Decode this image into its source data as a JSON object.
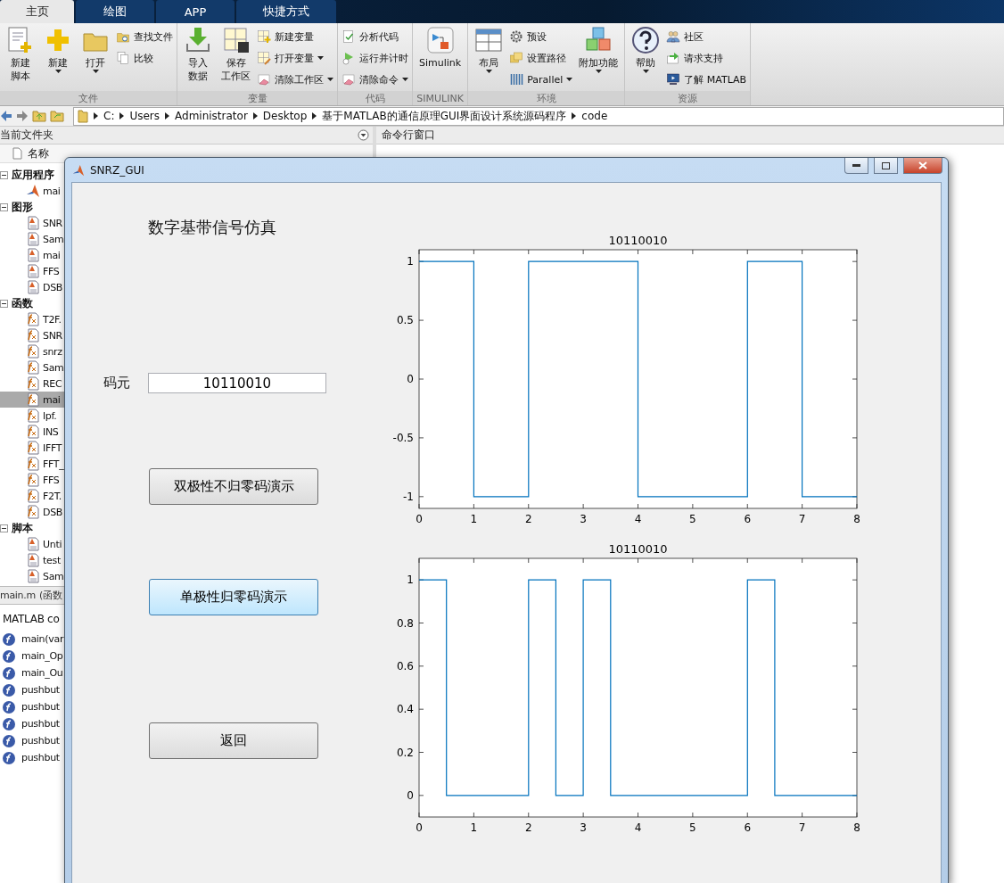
{
  "ribbon_tabs": [
    {
      "label": "主页",
      "selected": true
    },
    {
      "label": "绘图",
      "selected": false
    },
    {
      "label": "APP",
      "selected": false
    },
    {
      "label": "快捷方式",
      "selected": false
    }
  ],
  "ribbon_groups": [
    {
      "label": "文件",
      "items": [
        {
          "kind": "large",
          "lines": [
            "新建",
            "脚本"
          ],
          "dropdown": false
        },
        {
          "kind": "large",
          "lines": [
            "新建"
          ],
          "dropdown": true
        },
        {
          "kind": "large",
          "lines": [
            "打开"
          ],
          "dropdown": true
        },
        {
          "kind": "stack",
          "buttons": [
            {
              "label": "查找文件",
              "dropdown": false
            },
            {
              "label": "比较",
              "dropdown": false
            }
          ]
        }
      ]
    },
    {
      "label": "变量",
      "items": [
        {
          "kind": "large",
          "lines": [
            "导入",
            "数据"
          ],
          "dropdown": false
        },
        {
          "kind": "large",
          "lines": [
            "保存",
            "工作区"
          ],
          "dropdown": false
        },
        {
          "kind": "stack",
          "buttons": [
            {
              "label": "新建变量",
              "dropdown": false
            },
            {
              "label": "打开变量",
              "dropdown": true
            },
            {
              "label": "清除工作区",
              "dropdown": true
            }
          ]
        }
      ]
    },
    {
      "label": "代码",
      "items": [
        {
          "kind": "stack",
          "buttons": [
            {
              "label": "分析代码",
              "dropdown": false
            },
            {
              "label": "运行并计时",
              "dropdown": false
            },
            {
              "label": "清除命令",
              "dropdown": true
            }
          ]
        }
      ]
    },
    {
      "label": "SIMULINK",
      "items": [
        {
          "kind": "large",
          "lines": [
            "Simulink"
          ],
          "dropdown": false
        }
      ]
    },
    {
      "label": "环境",
      "items": [
        {
          "kind": "large",
          "lines": [
            "布局"
          ],
          "dropdown": true
        },
        {
          "kind": "stack",
          "buttons": [
            {
              "label": "预设",
              "dropdown": false
            },
            {
              "label": "设置路径",
              "dropdown": false
            },
            {
              "label": "Parallel",
              "dropdown": true
            }
          ]
        },
        {
          "kind": "large",
          "lines": [
            "附加功能"
          ],
          "dropdown": true
        }
      ]
    },
    {
      "label": "资源",
      "items": [
        {
          "kind": "large",
          "lines": [
            "帮助"
          ],
          "dropdown": true
        },
        {
          "kind": "stack",
          "buttons": [
            {
              "label": "社区",
              "dropdown": false
            },
            {
              "label": "请求支持",
              "dropdown": false
            },
            {
              "label": "了解 MATLAB",
              "dropdown": false
            }
          ]
        }
      ]
    }
  ],
  "path_bar": {
    "crumbs": [
      "C:",
      "Users",
      "Administrator",
      "Desktop",
      "基于MATLAB的通信原理GUI界面设计系统源码程序",
      "code"
    ]
  },
  "current_folder": {
    "title": "当前文件夹",
    "column": "名称",
    "groups": [
      {
        "label": "应用程序",
        "expanded": true,
        "children": [
          {
            "name": "mai",
            "selected": false
          }
        ]
      },
      {
        "label": "图形",
        "expanded": true,
        "children": [
          {
            "name": "SNR",
            "selected": false
          },
          {
            "name": "Sam",
            "selected": false
          },
          {
            "name": "mai",
            "selected": false
          },
          {
            "name": "FFS",
            "selected": false
          },
          {
            "name": "DSB",
            "selected": false
          }
        ]
      },
      {
        "label": "函数",
        "expanded": true,
        "children": [
          {
            "name": "T2F.",
            "selected": false
          },
          {
            "name": "SNR",
            "selected": false
          },
          {
            "name": "snrz",
            "selected": false
          },
          {
            "name": "Sam",
            "selected": false
          },
          {
            "name": "REC",
            "selected": false
          },
          {
            "name": "mai",
            "selected": true
          },
          {
            "name": "lpf.",
            "selected": false
          },
          {
            "name": "INS",
            "selected": false
          },
          {
            "name": "IFFT",
            "selected": false
          },
          {
            "name": "FFT_",
            "selected": false
          },
          {
            "name": "FFS",
            "selected": false
          },
          {
            "name": "F2T.",
            "selected": false
          },
          {
            "name": "DSB",
            "selected": false
          }
        ]
      },
      {
        "label": "脚本",
        "expanded": true,
        "children": [
          {
            "name": "Unti",
            "selected": false
          },
          {
            "name": "test",
            "selected": false
          },
          {
            "name": "Sam",
            "selected": false
          }
        ]
      }
    ]
  },
  "details": {
    "file": "main.m",
    "type": "(函数",
    "description": "MATLAB co",
    "functions": [
      "main(var",
      "main_Op",
      "main_Ou",
      "pushbut",
      "pushbut",
      "pushbut",
      "pushbut",
      "pushbut"
    ]
  },
  "command_window": {
    "title": "命令行窗口"
  },
  "gui_window": {
    "title": "SNRZ_GUI",
    "heading": "数字基带信号仿真",
    "code_label": "码元",
    "code_value": "10110010",
    "buttons": [
      {
        "label": "双极性不归零码演示",
        "focused": false
      },
      {
        "label": "单极性归零码演示",
        "focused": true
      },
      {
        "label": "返回",
        "focused": false
      }
    ],
    "plots": [
      {
        "chart_data": {
          "type": "line",
          "title": "10110010",
          "x": [
            0,
            1,
            1,
            2,
            2,
            4,
            4,
            6,
            6,
            7,
            7,
            8
          ],
          "series": [
            {
              "color": "#0072bd",
              "values": [
                1,
                1,
                -1,
                -1,
                1,
                1,
                -1,
                -1,
                1,
                1,
                -1,
                -1
              ]
            }
          ],
          "xlim": [
            0,
            8
          ],
          "ylim": [
            -1.1,
            1.1
          ],
          "xticks": [
            0,
            1,
            2,
            3,
            4,
            5,
            6,
            7,
            8
          ],
          "yticks": [
            -1,
            -0.5,
            0,
            0.5,
            1
          ]
        }
      },
      {
        "chart_data": {
          "type": "line",
          "title": "10110010",
          "x": [
            0,
            0.5,
            0.5,
            2,
            2,
            2.5,
            2.5,
            3,
            3,
            3.5,
            3.5,
            6,
            6,
            6.5,
            6.5,
            8
          ],
          "series": [
            {
              "color": "#0072bd",
              "values": [
                1,
                1,
                0,
                0,
                1,
                1,
                0,
                0,
                1,
                1,
                0,
                0,
                1,
                1,
                0,
                0
              ]
            }
          ],
          "xlim": [
            0,
            8
          ],
          "ylim": [
            -0.1,
            1.1
          ],
          "xticks": [
            0,
            1,
            2,
            3,
            4,
            5,
            6,
            7,
            8
          ],
          "yticks": [
            0,
            0.2,
            0.4,
            0.6,
            0.8,
            1
          ]
        }
      }
    ]
  }
}
